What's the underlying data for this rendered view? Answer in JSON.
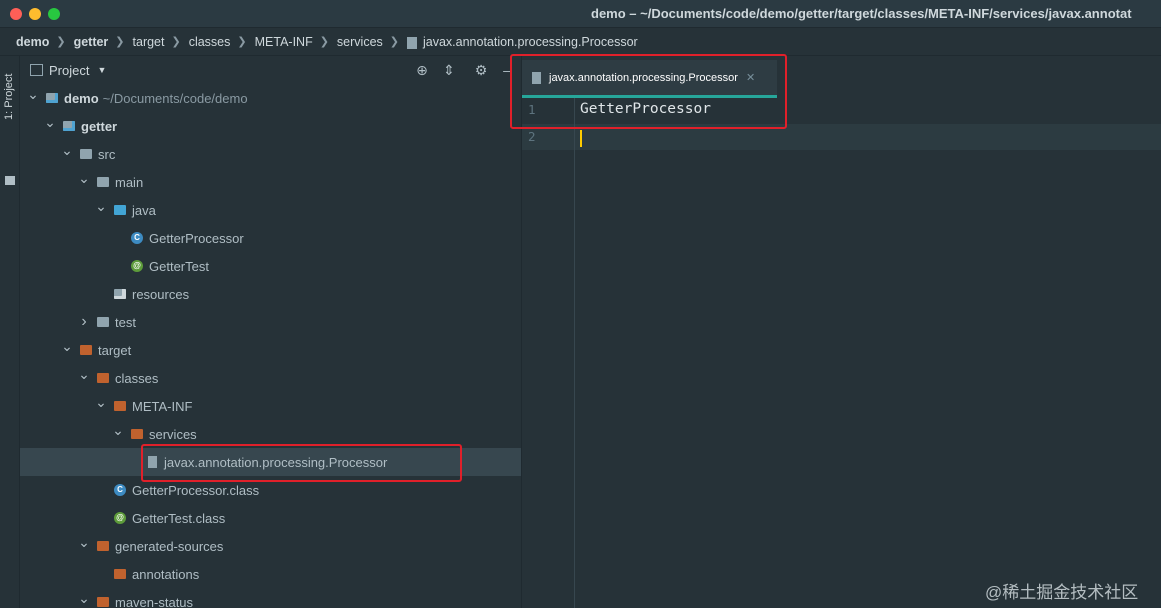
{
  "window": {
    "title": "demo – ~/Documents/code/demo/getter/target/classes/META-INF/services/javax.annotat"
  },
  "breadcrumb": [
    {
      "label": "demo",
      "bold": true
    },
    {
      "label": "getter",
      "bold": true
    },
    {
      "label": "target",
      "bold": false
    },
    {
      "label": "classes",
      "bold": false
    },
    {
      "label": "META-INF",
      "bold": false
    },
    {
      "label": "services",
      "bold": false
    },
    {
      "label": "javax.annotation.processing.Processor",
      "bold": false,
      "file": true
    }
  ],
  "sidebar_strip": {
    "label": "1: Project"
  },
  "project_pane": {
    "title": "Project",
    "tree": [
      {
        "label": "demo",
        "path": "~/Documents/code/demo",
        "level": 0,
        "arrow": "down",
        "icon": "module",
        "bold": true
      },
      {
        "label": "getter",
        "level": 1,
        "arrow": "down",
        "icon": "module",
        "bold": true
      },
      {
        "label": "src",
        "level": 2,
        "arrow": "down",
        "icon": "folder-gray"
      },
      {
        "label": "main",
        "level": 3,
        "arrow": "down",
        "icon": "folder-gray"
      },
      {
        "label": "java",
        "level": 4,
        "arrow": "down",
        "icon": "folder-blue"
      },
      {
        "label": "GetterProcessor",
        "level": 5,
        "arrow": "none",
        "icon": "class"
      },
      {
        "label": "GetterTest",
        "level": 5,
        "arrow": "none",
        "icon": "test"
      },
      {
        "label": "resources",
        "level": 4,
        "arrow": "none",
        "icon": "res"
      },
      {
        "label": "test",
        "level": 3,
        "arrow": "right",
        "icon": "folder-gray"
      },
      {
        "label": "target",
        "level": 2,
        "arrow": "down",
        "icon": "folder-orange"
      },
      {
        "label": "classes",
        "level": 3,
        "arrow": "down",
        "icon": "folder-orange"
      },
      {
        "label": "META-INF",
        "level": 4,
        "arrow": "down",
        "icon": "folder-orange"
      },
      {
        "label": "services",
        "level": 5,
        "arrow": "down",
        "icon": "folder-orange"
      },
      {
        "label": "javax.annotation.processing.Processor",
        "level": 6,
        "arrow": "none",
        "icon": "doc",
        "selected": true
      },
      {
        "label": "GetterProcessor.class",
        "level": 4,
        "arrow": "none",
        "icon": "class"
      },
      {
        "label": "GetterTest.class",
        "level": 4,
        "arrow": "none",
        "icon": "test"
      },
      {
        "label": "generated-sources",
        "level": 3,
        "arrow": "down",
        "icon": "folder-orange"
      },
      {
        "label": "annotations",
        "level": 4,
        "arrow": "none",
        "icon": "folder-orange"
      },
      {
        "label": "maven-status",
        "level": 3,
        "arrow": "down",
        "icon": "folder-orange"
      }
    ]
  },
  "editor": {
    "tab_label": "javax.annotation.processing.Processor",
    "lines": [
      {
        "num": "1",
        "text": "GetterProcessor"
      },
      {
        "num": "2",
        "text": ""
      }
    ]
  },
  "watermark": "@稀土掘金技术社区",
  "colors": {
    "background": "#263238",
    "accent_tab": "#26a69a",
    "highlight_box": "#e0202a",
    "caret": "#ffcc00"
  }
}
